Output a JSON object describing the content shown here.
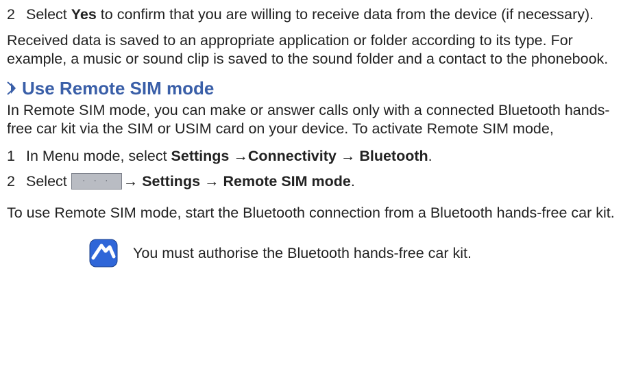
{
  "top_step": {
    "num": "2",
    "pre": "Select ",
    "bold": "Yes",
    "post": " to confirm that you are willing to receive data from the device (if necessary)."
  },
  "para1": "Received data is saved to an appropriate application or folder according to its type. For example, a music or sound clip is saved to the sound folder and a contact to the phonebook.",
  "section": {
    "title": "Use Remote SIM mode"
  },
  "para2": "In Remote SIM mode, you can make or answer calls only with a connected Bluetooth hands-free car kit via the SIM or USIM card on your device. To activate Remote SIM mode,",
  "steps": [
    {
      "num": "1",
      "pre": "In Menu mode, select ",
      "bold1": "Settings ",
      "arrow1": "→",
      "bold2": "Connectivity ",
      "arrow2": "→ ",
      "bold3": "Bluetooth",
      "post": "."
    },
    {
      "num": "2",
      "pre": "Select  ",
      "after_icon": "→ ",
      "bold1": "Settings ",
      "arrow1": "→ ",
      "bold2": "Remote SIM mode",
      "post": "."
    }
  ],
  "para3": "To use Remote SIM mode, start the Bluetooth connection from a Bluetooth hands-free car kit.",
  "note": {
    "text": "You must authorise the Bluetooth hands-free car kit."
  }
}
